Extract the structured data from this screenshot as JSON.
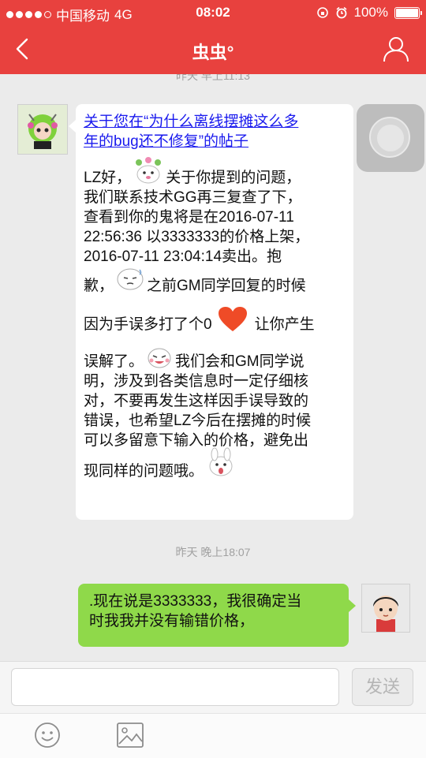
{
  "status_bar": {
    "carrier": "中国移动",
    "network": "4G",
    "time": "08:02",
    "battery": "100%"
  },
  "nav": {
    "title": "虫虫°"
  },
  "chat": {
    "top_timestamp": "昨天 早上11:13",
    "incoming": {
      "link_lines": [
        "关于您在“为什么离线摆摊这么多",
        "年的bug还不修复”的帖子"
      ],
      "lines": [
        " LZ好，",
        "关于你提到的问题，",
        "我们联系技术GG再三复查了下，",
        "查看到你的鬼将是在2016-07-11",
        "22:56:36 以3333333的价格上架，",
        "2016-07-11 23:04:14卖出。抱",
        "歉，",
        "之前GM同学回复的时候",
        "因为手误多打了个0",
        "让你产生",
        "误解了。",
        "我们会和GM同学说",
        "明，涉及到各类信息时一定仔细核",
        "对，不要再发生这样因手误导致的",
        "错误，也希望LZ今后在摆摊的时候",
        "可以多留意下输入的价格，避免出",
        "现同样的问题哦。"
      ]
    },
    "mid_timestamp": "昨天 晚上18:07",
    "outgoing": {
      "lines": [
        ".现在说是3333333，我很确定当",
        "时我我并没有输错价格，"
      ]
    }
  },
  "input": {
    "value": "",
    "send_label": "发送"
  },
  "colors": {
    "header": "#e8413e",
    "outgoing_bubble": "#8fd94a",
    "link": "#1a1aee"
  },
  "icons": [
    "back-icon",
    "user-icon",
    "smiley-icon",
    "image-icon",
    "heart-icon"
  ]
}
